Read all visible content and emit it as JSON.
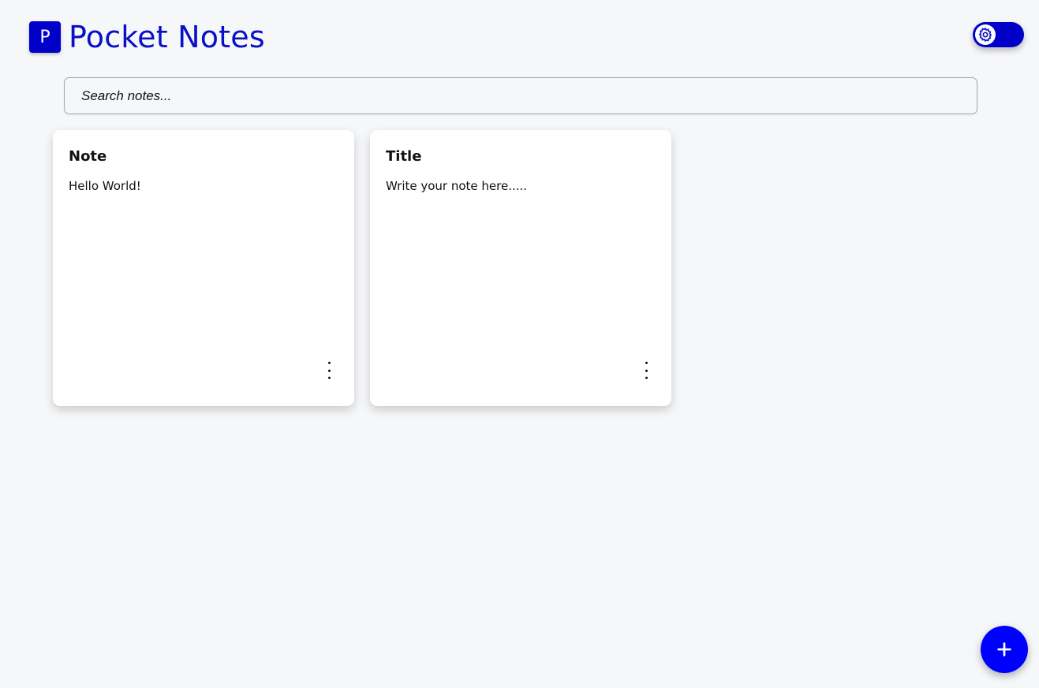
{
  "app": {
    "logo_letter": "P",
    "title": "Pocket Notes"
  },
  "theme_toggle": {
    "icon": "gear-icon"
  },
  "search": {
    "placeholder": "Search notes...",
    "value": ""
  },
  "notes": [
    {
      "title": "Note",
      "body": "Hello World!"
    },
    {
      "title": "Title",
      "body": "Write your note here....."
    }
  ],
  "fab": {
    "icon": "plus-icon"
  },
  "colors": {
    "brand": "#0000c8",
    "fab": "#0000ff",
    "background": "#f6f7f9"
  }
}
